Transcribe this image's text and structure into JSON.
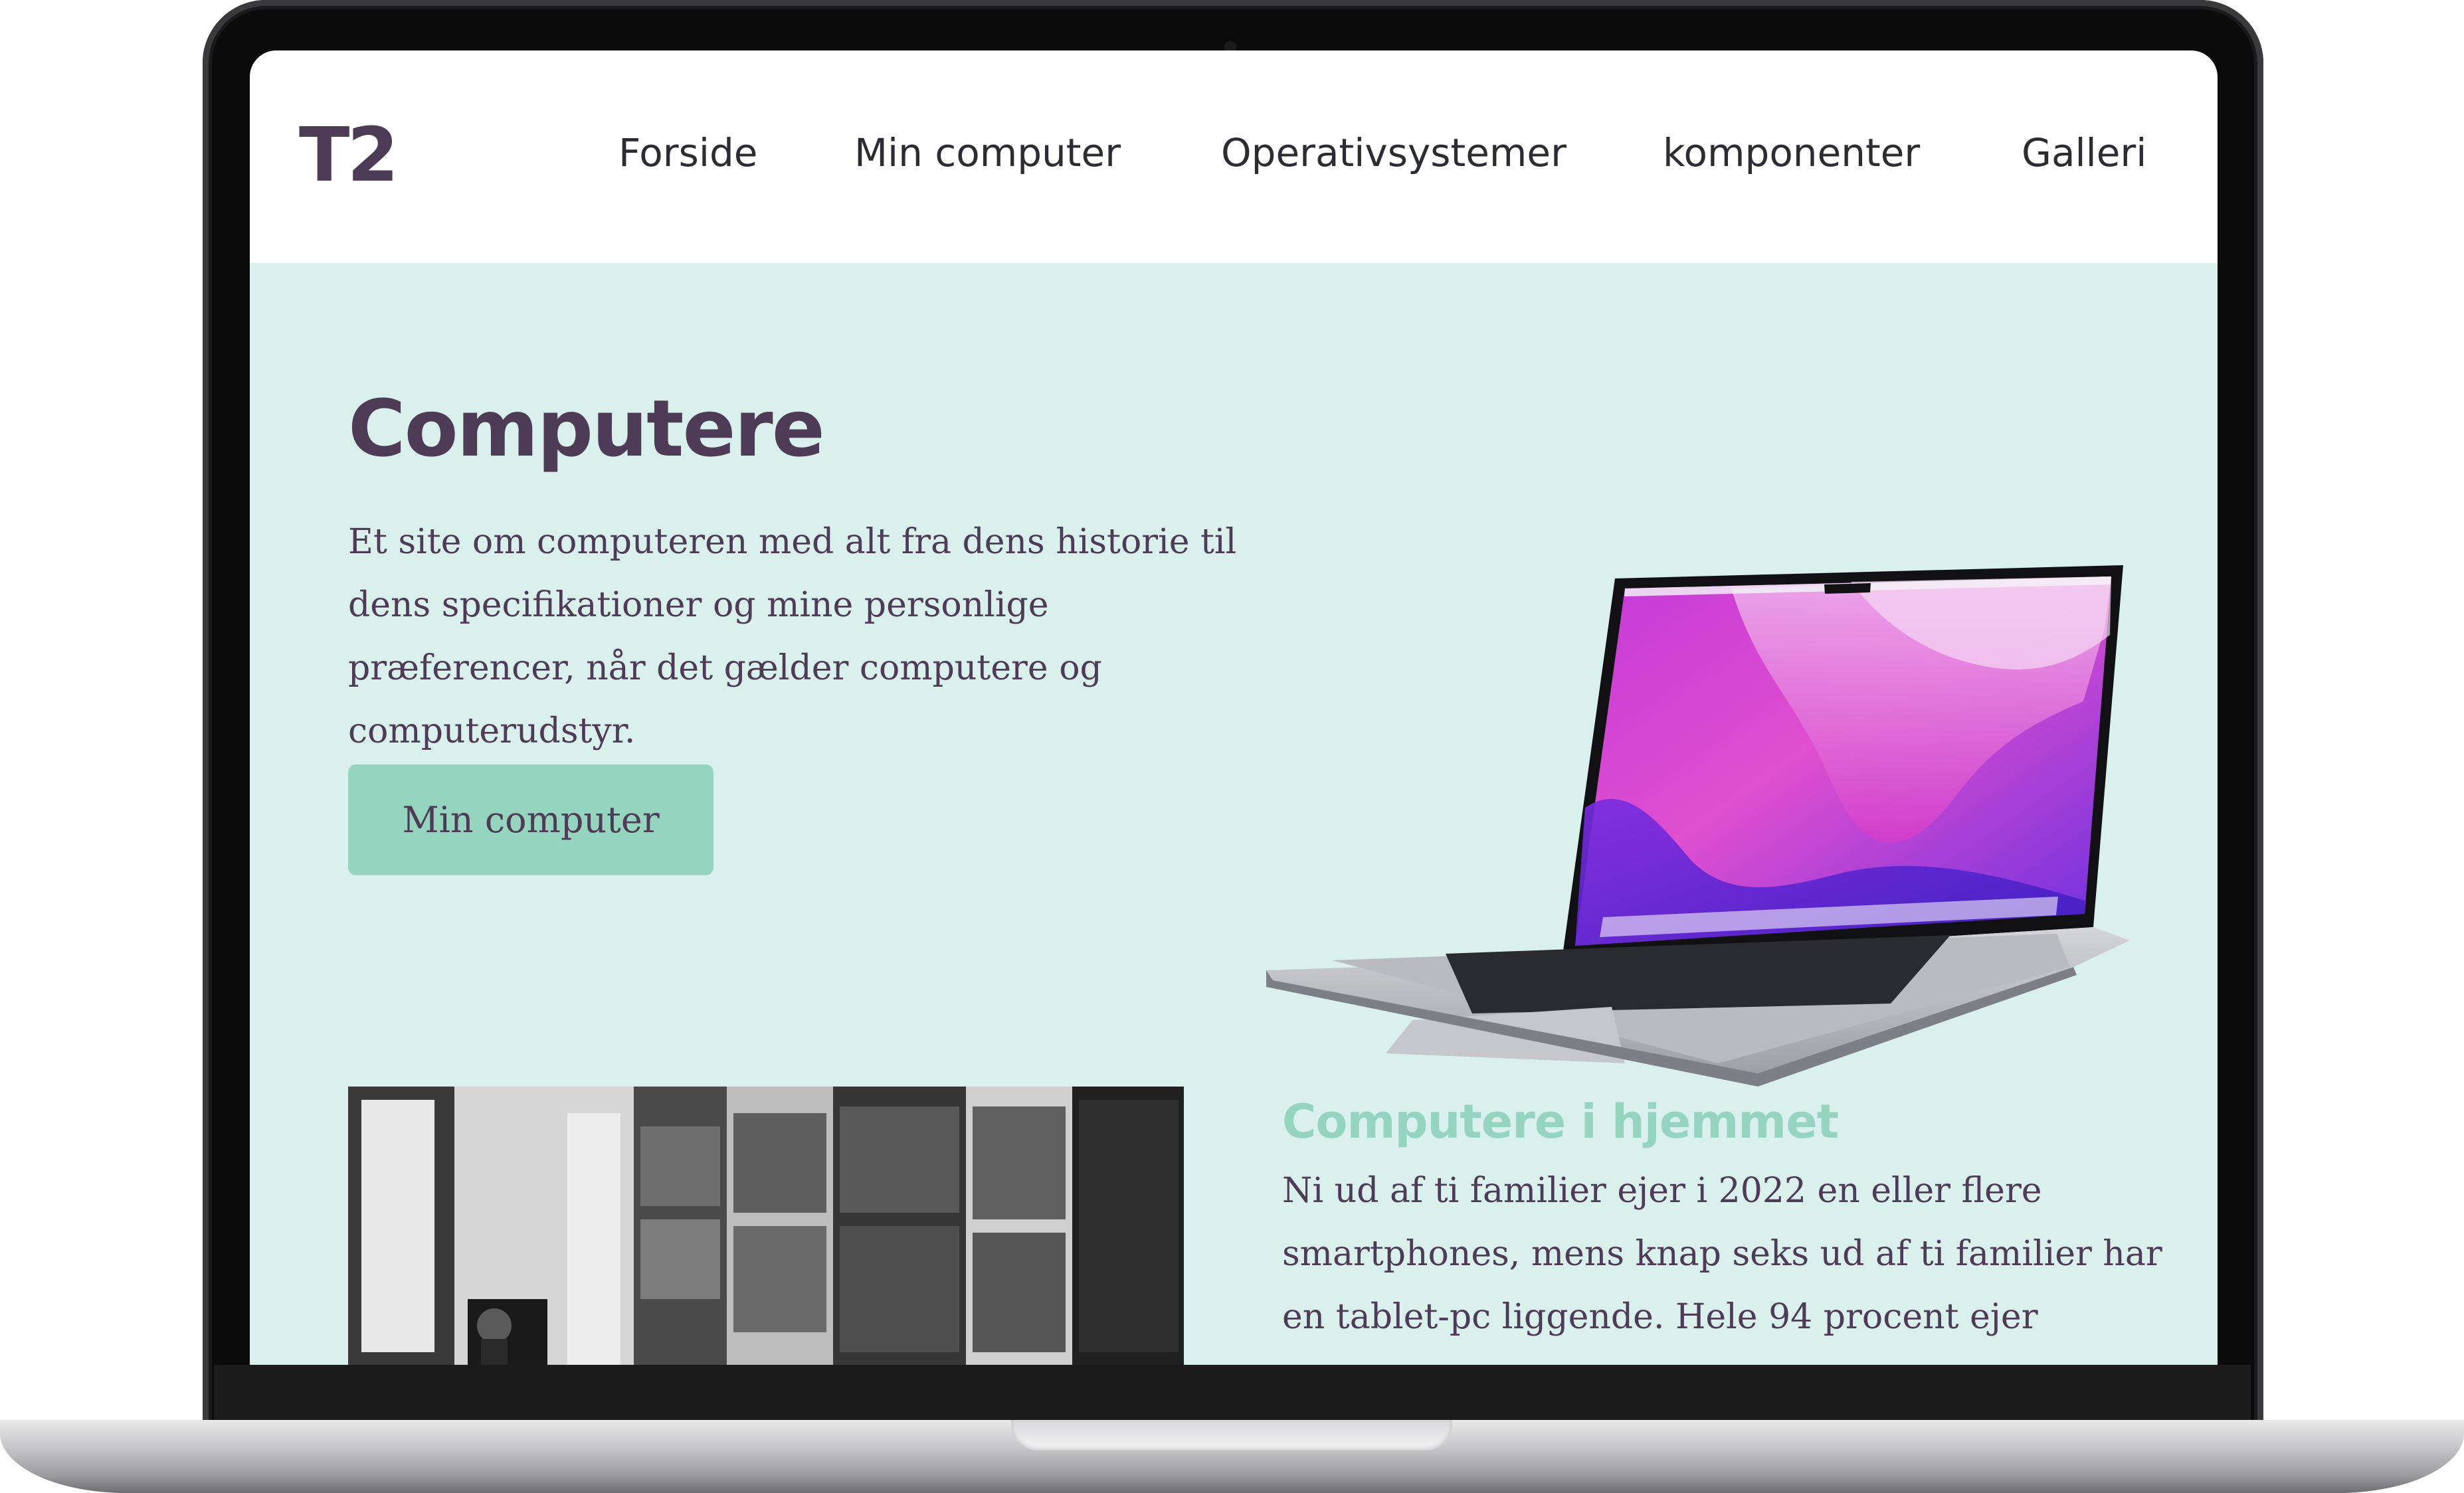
{
  "site": {
    "logo": "T2",
    "nav": [
      "Forside",
      "Min computer",
      "Operativsystemer",
      "komponenter",
      "Galleri"
    ]
  },
  "hero": {
    "title": "Computere",
    "text": "Et site om computeren med alt fra dens historie til dens specifikationer og mine personlige præferencer, når det gælder computere og computerudstyr.",
    "button_label": "Min computer"
  },
  "section": {
    "title": "Computere i hjemmet",
    "text": "Ni ud af ti familier ejer i 2022 en eller flere smartphones, mens knap seks ud af ti familier har en tablet-pc liggende. Hele 94 procent ejer"
  },
  "colors": {
    "brand_purple": "#4e3b55",
    "mint": "#95d5c0",
    "hero_background": "#d9f0ec"
  }
}
